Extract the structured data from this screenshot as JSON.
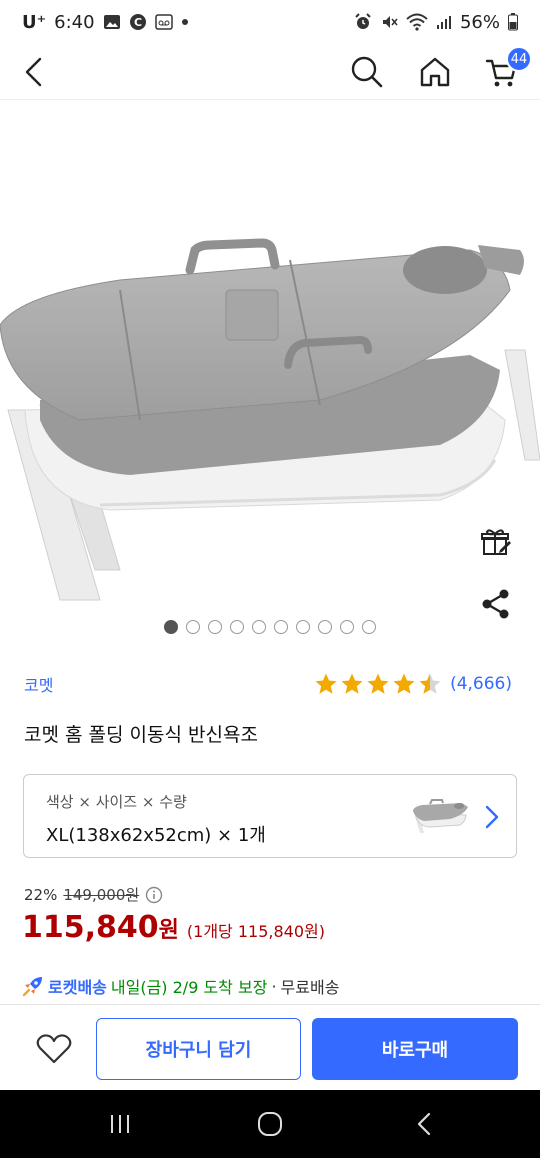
{
  "status_bar": {
    "carrier": "U⁺",
    "time": "6:40",
    "battery": "56%",
    "icons_left": [
      "image-icon",
      "c-badge-icon",
      "voicemail-icon",
      "dot-icon"
    ],
    "icons_right": [
      "alarm-icon",
      "mute-icon",
      "wifi-icon",
      "signal-icon",
      "battery-icon"
    ]
  },
  "top_nav": {
    "back_icon": "chevron-left-icon",
    "search_icon": "search-icon",
    "home_icon": "home-icon",
    "cart_icon": "cart-icon",
    "cart_count": "44"
  },
  "hero": {
    "side_buttons": [
      "gift-icon",
      "share-icon"
    ],
    "dots_total": 10,
    "active_dot": 0
  },
  "product": {
    "brand": "코멧",
    "rating": 4.5,
    "review_count": "(4,666)",
    "title": "코멧 홈 폴딩 이동식 반신욕조"
  },
  "option": {
    "label": "색상 × 사이즈 × 수량",
    "value": "XL(138x62x52cm) × 1개"
  },
  "pricing": {
    "discount": "22%",
    "original_price": "149,000원",
    "price": "115,840",
    "price_unit": "원",
    "unit_price": "(1개당 115,840원)"
  },
  "delivery": {
    "rocket_label": "로켓배송",
    "arrival": "내일(금) 2/9 도착 보장",
    "separator": "·",
    "shipping": "무료배송"
  },
  "actions": {
    "wish_icon": "heart-icon",
    "cart_label": "장바구니 담기",
    "buy_label": "바로구매"
  },
  "colors": {
    "accent": "#346aff",
    "price": "#ae0000",
    "arrival": "#008c00",
    "star": "#f2a900"
  },
  "system_nav": [
    "recent-apps-icon",
    "home-circle-icon",
    "back-icon"
  ]
}
